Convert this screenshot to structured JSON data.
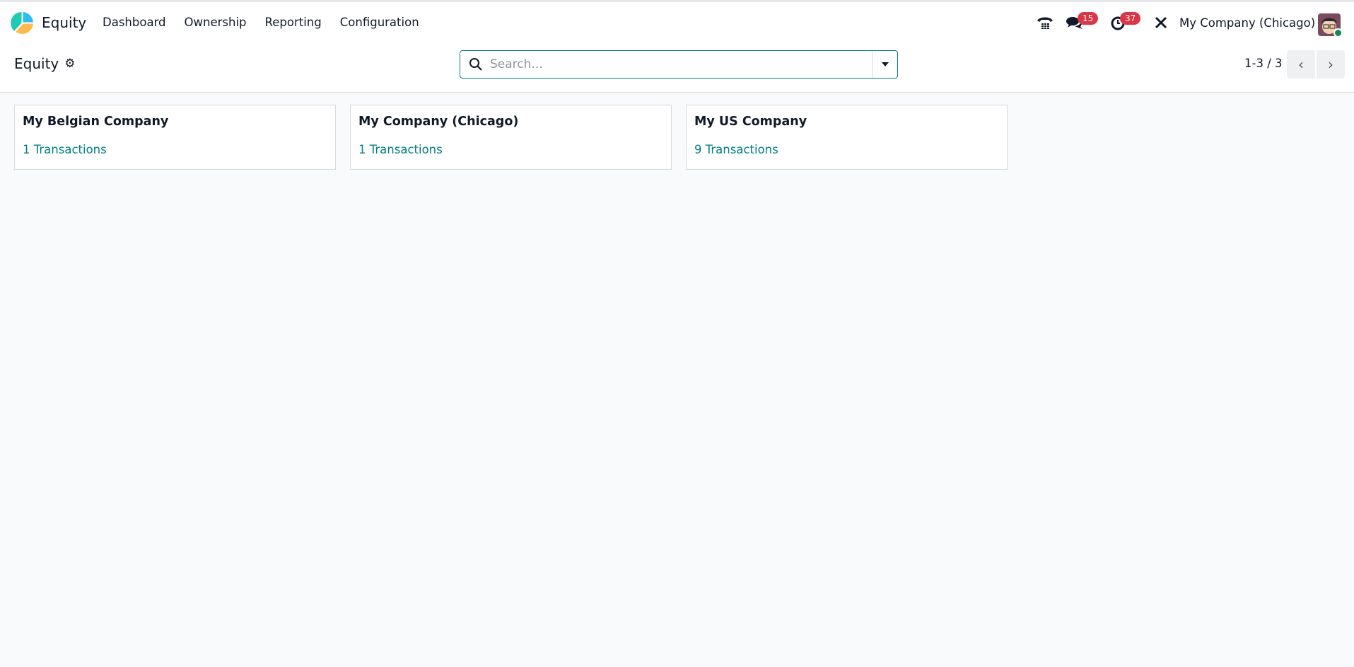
{
  "navbar": {
    "app_name": "Equity",
    "menu": [
      "Dashboard",
      "Ownership",
      "Reporting",
      "Configuration"
    ],
    "messages_count": "15",
    "activities_count": "37",
    "company": "My Company (Chicago)"
  },
  "control": {
    "title": "Equity",
    "search_placeholder": "Search...",
    "pager": "1-3 / 3"
  },
  "cards": [
    {
      "name": "My Belgian Company",
      "transactions": "1 Transactions"
    },
    {
      "name": "My Company (Chicago)",
      "transactions": "1 Transactions"
    },
    {
      "name": "My US Company",
      "transactions": "9 Transactions"
    }
  ],
  "colors": {
    "accent": "#017e84",
    "badge": "#dc3545"
  }
}
